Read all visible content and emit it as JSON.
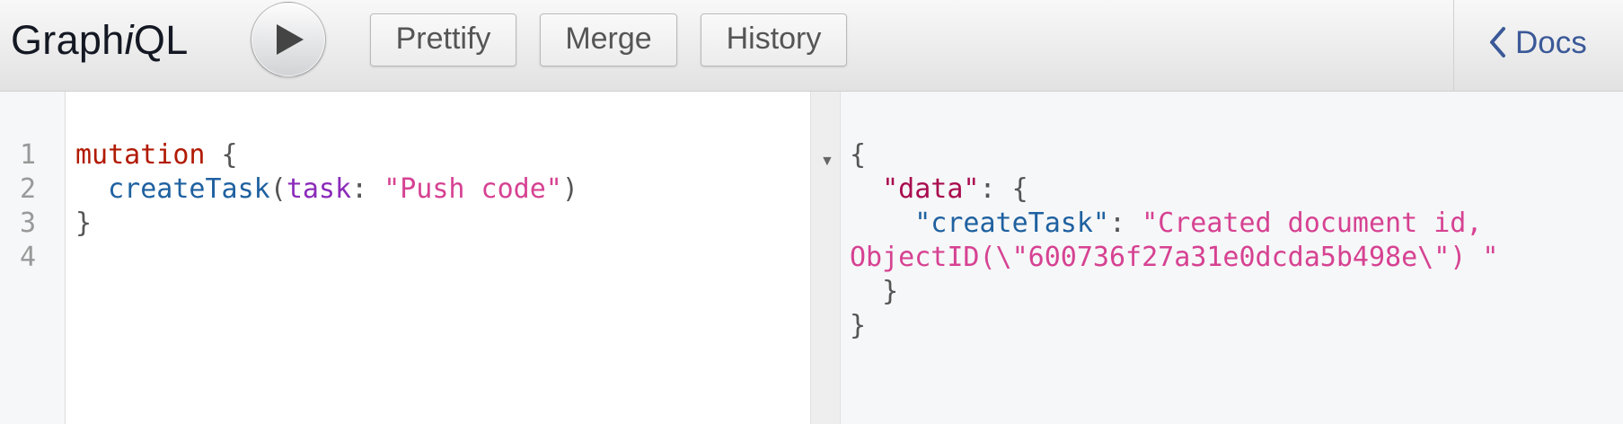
{
  "toolbar": {
    "logo_prefix": "Graph",
    "logo_italic": "i",
    "logo_suffix": "QL",
    "run_icon": "play-icon",
    "prettify_label": "Prettify",
    "merge_label": "Merge",
    "history_label": "History",
    "docs_label": "Docs",
    "docs_icon": "chevron-left-icon"
  },
  "editor": {
    "line_numbers": [
      "1",
      "2",
      "3",
      "4"
    ],
    "line1": {
      "keyword": "mutation",
      "brace": " {"
    },
    "line2": {
      "indent": "  ",
      "field": "createTask",
      "open_paren": "(",
      "arg": "task",
      "colon": ": ",
      "value": "\"Push code\"",
      "close_paren": ")"
    },
    "line3": {
      "brace": "}"
    }
  },
  "result": {
    "fold_icon": "fold-triangle-icon",
    "line1": "{",
    "line2": {
      "indent": "  ",
      "key": "\"data\"",
      "rest": ": {"
    },
    "line3": {
      "indent": "    ",
      "key": "\"createTask\"",
      "colon": ": ",
      "value_part1": "\"Created document id,"
    },
    "line4": {
      "value_part2": "ObjectID(\\\"600736f27a31e0dcda5b498e\\\") \""
    },
    "line5": "  }",
    "line6": "}"
  },
  "colors": {
    "keyword": "#B11A04",
    "def": "#1F61A0",
    "attribute": "#8B2BB9",
    "string": "#D64292",
    "json_key": "#A90D4F",
    "docs_link": "#3B5998"
  }
}
